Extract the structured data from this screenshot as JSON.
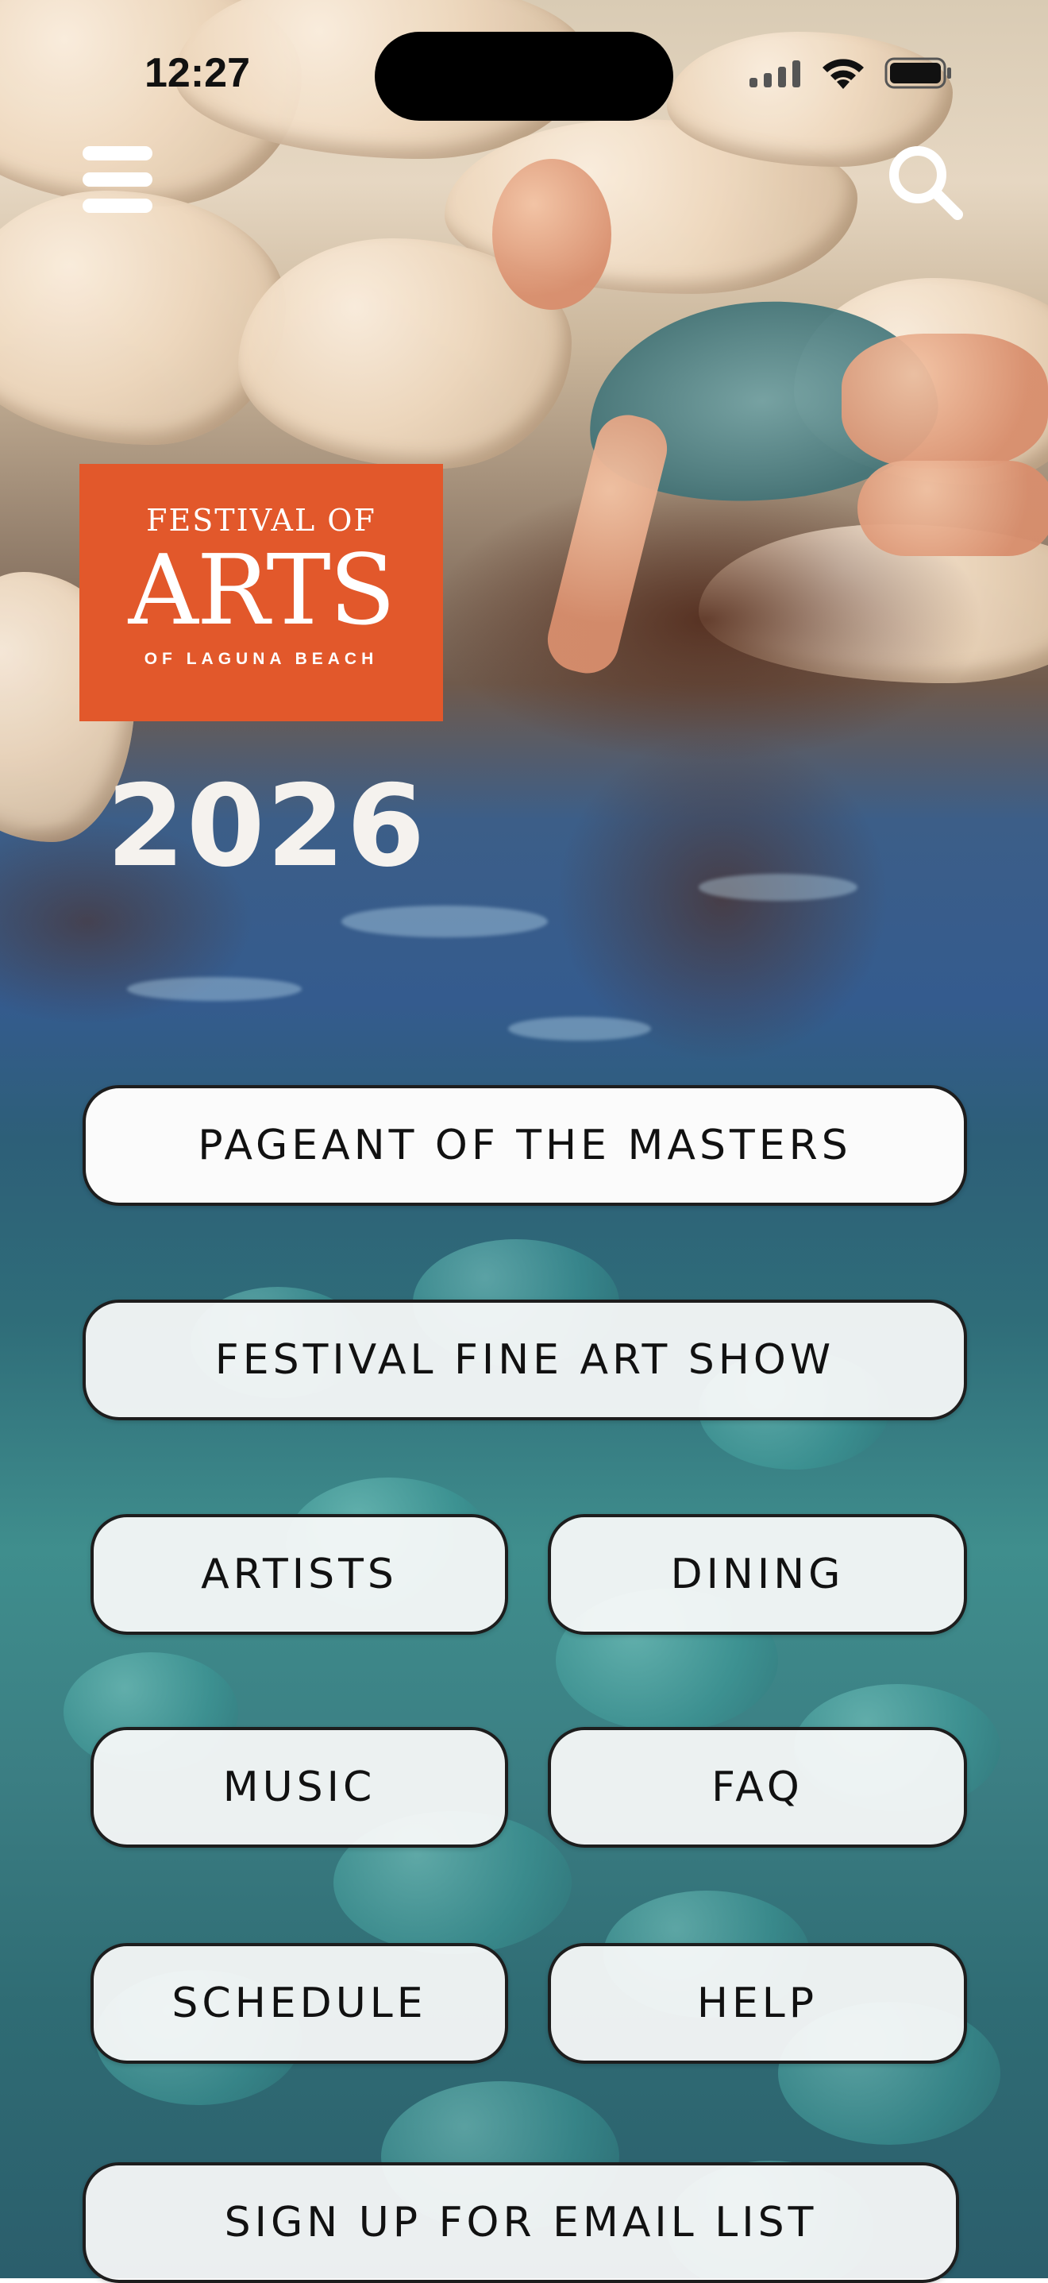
{
  "status_bar": {
    "time": "12:27"
  },
  "header": {
    "menu_icon": "hamburger-menu-icon",
    "search_icon": "search-icon"
  },
  "logo": {
    "line1": "FESTIVAL OF",
    "line2": "ARTS",
    "line3": "OF LAGUNA BEACH",
    "color": "#e2582b"
  },
  "year": "2026",
  "buttons": {
    "pageant": "PAGEANT OF THE MASTERS",
    "fine_art_show": "FESTIVAL FINE ART SHOW",
    "artists": "ARTISTS",
    "dining": "DINING",
    "music": "MUSIC",
    "faq": "FAQ",
    "schedule": "SCHEDULE",
    "help": "HELP",
    "email_signup": "SIGN UP FOR EMAIL LIST"
  }
}
